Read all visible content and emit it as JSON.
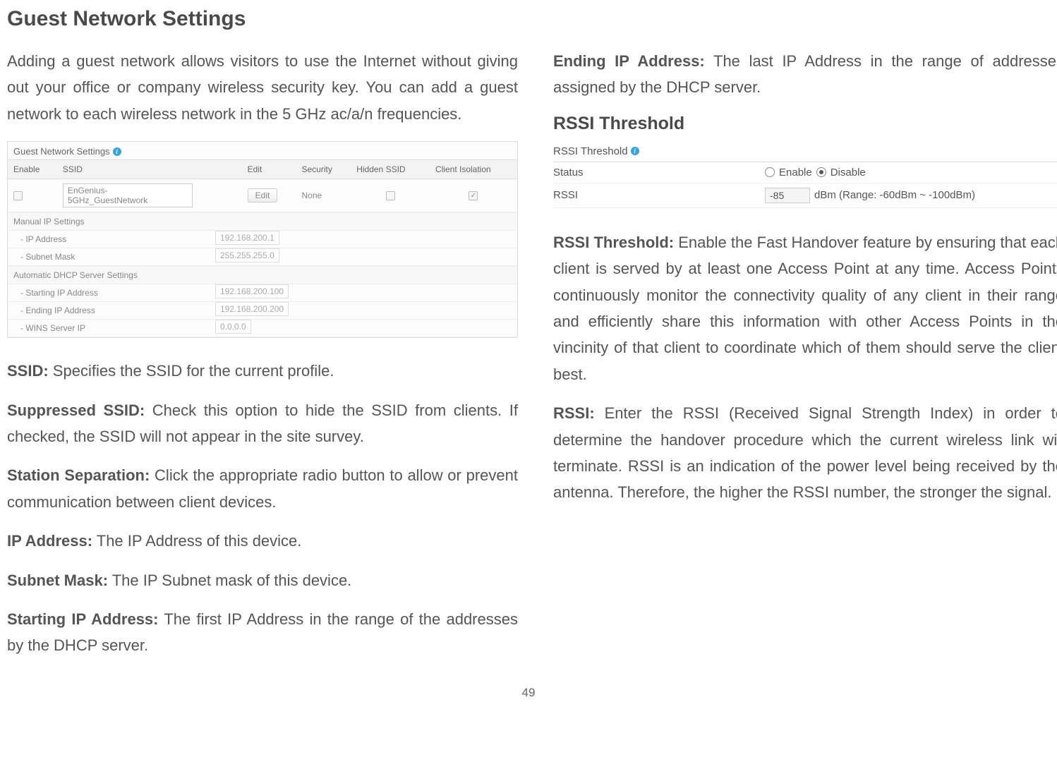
{
  "left": {
    "heading": "Guest Network Settings",
    "intro": "Adding a guest network allows visitors to use the Internet without giving out your office or company wireless security key. You can add a guest network to each wireless network in the 5 GHz ac/a/n frequencies.",
    "shot": {
      "title": "Guest Network Settings",
      "headers": {
        "enable": "Enable",
        "ssid": "SSID",
        "edit": "Edit",
        "security": "Security",
        "hidden": "Hidden SSID",
        "isolation": "Client Isolation"
      },
      "row": {
        "ssid_value": "EnGenius-5GHz_GuestNetwork",
        "edit_label": "Edit",
        "security_value": "None"
      },
      "manual_label": "Manual IP Settings",
      "ip_addr_label": "- IP Address",
      "ip_addr_value": "192.168.200.1",
      "subnet_label": "- Subnet Mask",
      "subnet_value": "255.255.255.0",
      "dhcp_label": "Automatic DHCP Server Settings",
      "start_ip_label": "- Starting IP Address",
      "start_ip_value": "192.168.200.100",
      "end_ip_label": "- Ending IP Address",
      "end_ip_value": "192.168.200.200",
      "wins_label": "- WINS Server IP",
      "wins_value": "0.0.0.0"
    },
    "defs": {
      "ssid_label": "SSID:",
      "ssid_text": " Specifies the SSID for the current profile.",
      "sup_label": "Suppressed SSID:",
      "sup_text": " Check this option to hide the SSID from clients. If checked, the SSID will not appear in the site survey.",
      "sep_label": "Station Separation:",
      "sep_text": " Click the appropriate radio button to allow or prevent communication between client devices.",
      "ip_label": "IP Address:",
      "ip_text": " The IP Address of this device.",
      "sub_label": "Subnet Mask:",
      "sub_text": " The IP Subnet mask of this device.",
      "start_label": "Starting IP Address:",
      "start_text": " The first IP Address in the range of the addresses by the DHCP server."
    }
  },
  "right": {
    "end_label": "Ending IP Address:",
    "end_text": " The last IP Address in the range of addresses assigned by the DHCP server.",
    "rssi_heading": "RSSI Threshold",
    "rssi_shot": {
      "title": "RSSI Threshold",
      "status_label": "Status",
      "enable_label": "Enable",
      "disable_label": "Disable",
      "rssi_label": "RSSI",
      "rssi_value": "-85",
      "rssi_hint": "dBm (Range: -60dBm ~ -100dBm)"
    },
    "rssi_th_label": "RSSI Threshold:",
    "rssi_th_text": " Enable the Fast Handover feature by ensuring that each client is served by at least one Access Point at any time. Access Points continuously monitor the connectivity quality of any client in their range and efficiently share this information with other Access Points in the vincinity of that client to coordinate which of them should serve the client best.",
    "rssi_label": "RSSI:",
    "rssi_text": " Enter the RSSI (Received Signal Strength Index) in order to determine the handover procedure which the current wireless link will terminate. RSSI is an indication of the power level being received by the antenna. Therefore, the higher the RSSI number, the stronger the signal."
  },
  "page_number": "49"
}
